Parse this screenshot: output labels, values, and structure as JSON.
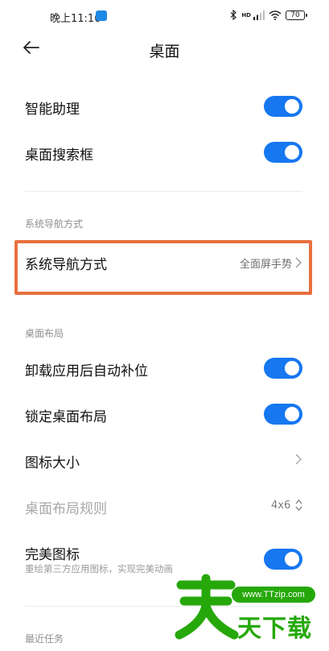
{
  "status_bar": {
    "time": "晚上11:16",
    "network_label": "HD",
    "battery": "70"
  },
  "header": {
    "title": "桌面",
    "back_icon": "arrow-left-icon"
  },
  "items": {
    "smart_assistant": {
      "label": "智能助理",
      "enabled": true
    },
    "desktop_search": {
      "label": "桌面搜索框",
      "enabled": true
    },
    "nav_section_title": "系统导航方式",
    "nav_method": {
      "label": "系统导航方式",
      "value": "全面屏手势"
    },
    "layout_section_title": "桌面布局",
    "auto_fill": {
      "label": "卸载应用后自动补位",
      "enabled": true
    },
    "lock_layout": {
      "label": "锁定桌面布局",
      "enabled": true
    },
    "icon_size": {
      "label": "图标大小"
    },
    "layout_rule": {
      "label": "桌面布局规则",
      "value": "4x6"
    },
    "perfect_icon": {
      "label": "完美图标",
      "description": "重绘第三方应用图标，实现完美动画",
      "enabled": true
    },
    "recent_section_title": "最近任务"
  },
  "watermark": {
    "url": "www.TTzip.com",
    "text": "天下载"
  },
  "colors": {
    "toggle_on": "#1677f0",
    "highlight": "#e8703e",
    "watermark": "#26a80a"
  }
}
